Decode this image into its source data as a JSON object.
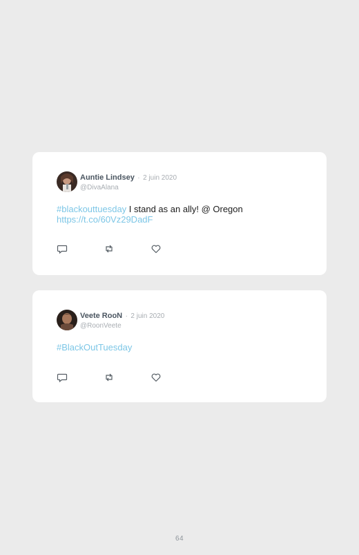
{
  "tweets": [
    {
      "author": "Auntie Lindsey",
      "separator": "·",
      "date": "2 juin 2020",
      "handle": "@DivaAlana",
      "hashtag": "#blackouttuesday",
      "text": " I stand as an ally! @ Oregon",
      "link": "https://t.co/60Vz29DadF",
      "icons": [
        "reply-icon",
        "retweet-icon",
        "like-icon"
      ]
    },
    {
      "author": "Veete RooN",
      "separator": "·",
      "date": "2 juin 2020",
      "handle": "@RoonVeete",
      "hashtag": "#BlackOutTuesday",
      "icons": [
        "reply-icon",
        "retweet-icon",
        "like-icon"
      ]
    }
  ],
  "page_number": "64",
  "colors": {
    "background": "#ebebeb",
    "card": "#ffffff",
    "link": "#7cc6e6",
    "name": "#4a5560",
    "muted": "#a8adb2"
  }
}
